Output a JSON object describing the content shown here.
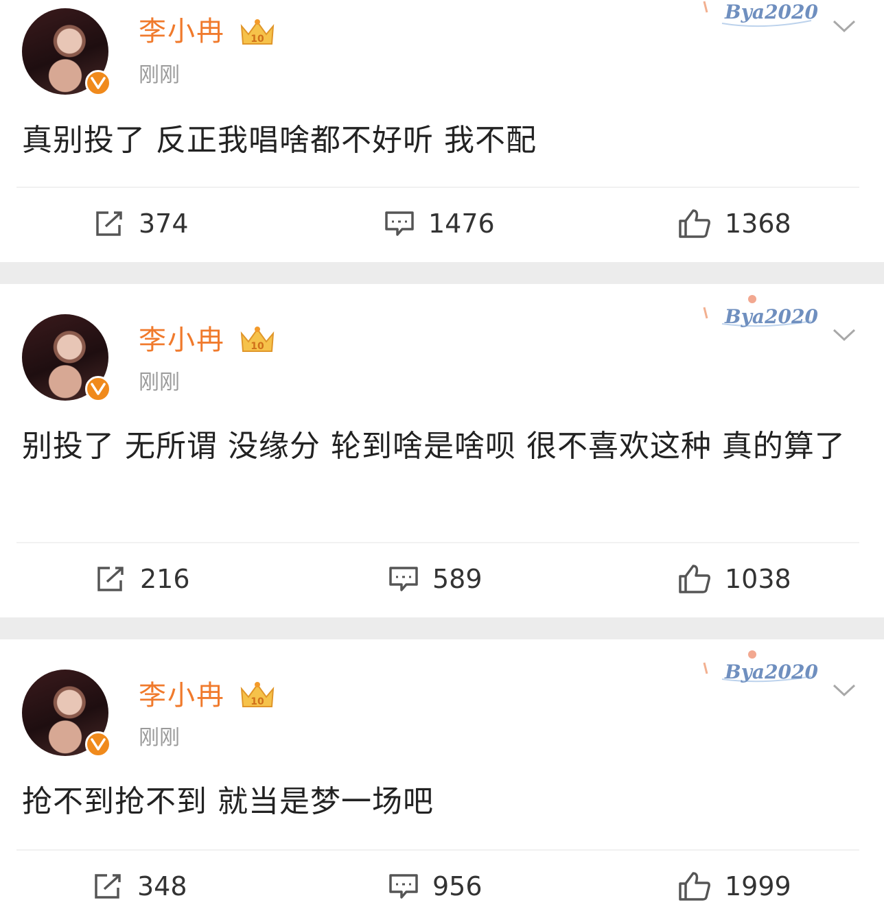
{
  "posts": [
    {
      "username": "李小冉",
      "time": "刚刚",
      "watermark": "Bya2020",
      "text": "真别投了 反正我唱啥都不好听 我不配",
      "reposts": "374",
      "comments": "1476",
      "likes": "1368"
    },
    {
      "username": "李小冉",
      "time": "刚刚",
      "watermark": "Bya2020",
      "text": "别投了 无所谓 没缘分 轮到啥是啥呗 很不喜欢这种 真的算了",
      "reposts": "216",
      "comments": "589",
      "likes": "1038"
    },
    {
      "username": "李小冉",
      "time": "刚刚",
      "watermark": "Bya2020",
      "text": "抢不到抢不到 就当是梦一场吧",
      "reposts": "348",
      "comments": "956",
      "likes": "1999"
    }
  ],
  "colors": {
    "username": "#f07a2c",
    "verified": "#f08a1c",
    "watermark": "#6f8fbf",
    "separator": "#ececec"
  },
  "icons": [
    "repost-icon",
    "comment-icon",
    "like-icon",
    "chevron-down-icon",
    "vip-crown-icon",
    "verified-icon"
  ]
}
